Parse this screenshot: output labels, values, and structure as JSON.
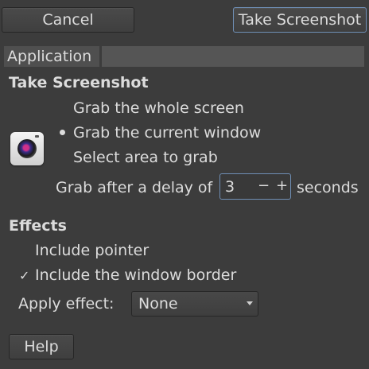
{
  "buttons": {
    "cancel": "Cancel",
    "take_screenshot": "Take Screenshot",
    "help": "Help"
  },
  "application": {
    "label": "Application",
    "value": ""
  },
  "take_screenshot": {
    "heading": "Take Screenshot",
    "options": [
      "Grab the whole screen",
      "Grab the current window",
      "Select area to grab"
    ],
    "selected_option": "Grab the current window",
    "delay_label": "Grab after a delay of",
    "delay_value": "3",
    "delay_unit": "seconds",
    "minus": "−",
    "plus": "+",
    "icon": "camera-icon"
  },
  "effects": {
    "heading": "Effects",
    "include_pointer": "Include pointer",
    "include_pointer_checked": false,
    "include_border": "Include the window border",
    "include_border_checked": true,
    "check_mark": "✓",
    "apply_effect_label": "Apply effect:",
    "apply_effect_value": "None"
  }
}
